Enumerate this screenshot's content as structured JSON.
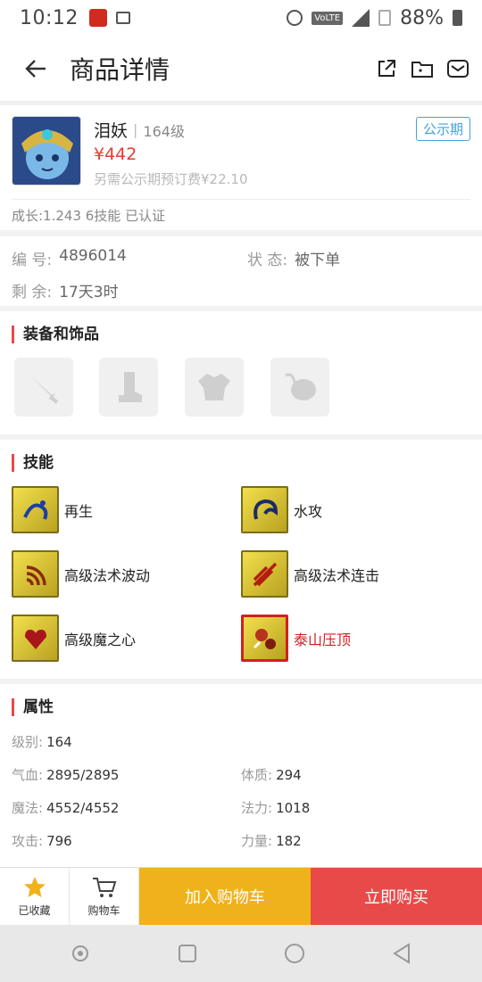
{
  "status_bar": {
    "time": "10:12",
    "network": "VoLTE",
    "signal": "4G",
    "battery": "88%"
  },
  "header": {
    "title": "商品详情"
  },
  "product": {
    "name": "泪妖",
    "level": "164级",
    "tag": "公示期",
    "price": "¥442",
    "fee_note": "另需公示期预订费¥22.10",
    "growth": "成长:1.243 6技能 已认证"
  },
  "info": {
    "id_label": "编  号:",
    "id_value": "4896014",
    "status_label": "状  态:",
    "status_value": "被下单",
    "remain_label": "剩  余:",
    "remain_value": "17天3时"
  },
  "equipment": {
    "title": "装备和饰品",
    "slots": [
      "weapon-icon",
      "boots-icon",
      "armor-icon",
      "accessory-icon"
    ]
  },
  "skills": {
    "title": "技能",
    "items": [
      {
        "name": "再生"
      },
      {
        "name": "水攻"
      },
      {
        "name": "高级法术波动"
      },
      {
        "name": "高级法术连击"
      },
      {
        "name": "高级魔之心"
      },
      {
        "name": "泰山压顶"
      }
    ]
  },
  "attributes": {
    "title": "属性",
    "level_label": "级别:",
    "level_value": "164",
    "hp_label": "气血:",
    "hp_value": "2895/2895",
    "con_label": "体质:",
    "con_value": "294",
    "mp_label": "魔法:",
    "mp_value": "4552/4552",
    "mag_label": "法力:",
    "mag_value": "1018",
    "atk_label": "攻击:",
    "atk_value": "796",
    "str_label": "力量:",
    "str_value": "182"
  },
  "bottom_bar": {
    "favorited": "已收藏",
    "cart": "购物车",
    "add_to_cart": "加入购物车",
    "buy_now": "立即购买"
  },
  "colors": {
    "price_red": "#e23b2f",
    "tag_blue": "#3ea3e0",
    "accent_red": "#e84a4a",
    "cart_yellow": "#f0b21a"
  }
}
